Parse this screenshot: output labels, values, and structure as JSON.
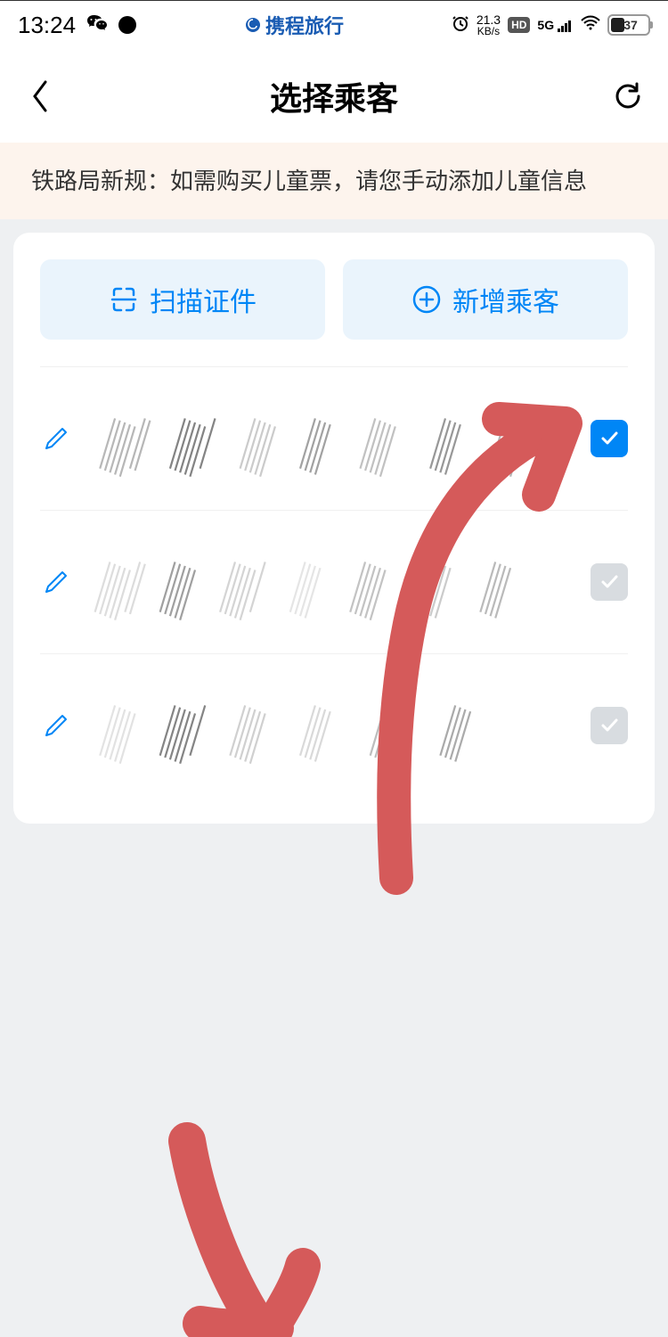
{
  "status_bar": {
    "time": "13:24",
    "app_name": "携程旅行",
    "speed_value": "21.3",
    "speed_unit": "KB/s",
    "hd_label": "HD",
    "network_label": "5G",
    "battery_level": "37"
  },
  "header": {
    "title": "选择乘客"
  },
  "notice": {
    "text": "铁路局新规：如需购买儿童票，请您手动添加儿童信息"
  },
  "actions": {
    "scan_label": "扫描证件",
    "add_label": "新增乘客"
  },
  "passengers": [
    {
      "checked": true
    },
    {
      "checked": false
    },
    {
      "checked": false
    }
  ],
  "colors": {
    "primary": "#0086f6",
    "background": "#eef0f2",
    "notice_bg": "#fdf4ed",
    "action_bg": "#eaf4fc",
    "annotation": "#d55a5a"
  }
}
